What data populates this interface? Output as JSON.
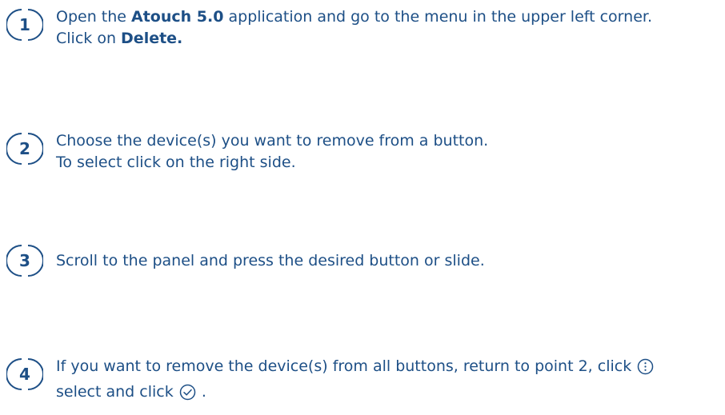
{
  "steps": [
    {
      "number": "1",
      "line1_part1": "Open the ",
      "line1_bold": "Atouch 5.0",
      "line1_part2": " application and go to the menu in the upper left corner.",
      "line2_part1": "Click on ",
      "line2_bold": "Delete."
    },
    {
      "number": "2",
      "line1": "Choose the device(s) you want to remove from a button.",
      "line2": "To select click on the right side."
    },
    {
      "number": "3",
      "line1": "Scroll to the panel and press the desired button or slide."
    },
    {
      "number": "4",
      "line1_part1": "If you want to remove the device(s) from all buttons, return to point 2, click ",
      "line1_icon": "more-options-icon",
      "line2_part1": "select and click ",
      "line2_icon": "check-circle-icon",
      "line2_part2": " ."
    }
  ],
  "colors": {
    "text": "#1d4f86",
    "background": "#ffffff"
  }
}
